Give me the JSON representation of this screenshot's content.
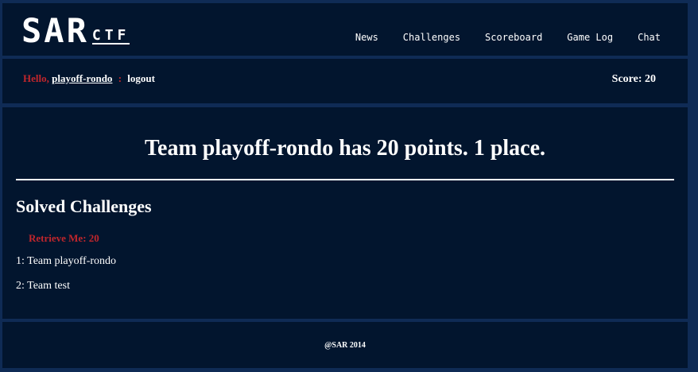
{
  "header": {
    "logo_big": "SAR",
    "logo_small": "CTF",
    "nav": [
      "News",
      "Challenges",
      "Scoreboard",
      "Game Log",
      "Chat"
    ]
  },
  "userbar": {
    "hello": "Hello,",
    "username": "playoff-rondo",
    "separator": ":",
    "logout": "logout",
    "score": "Score: 20"
  },
  "main": {
    "title": "Team playoff-rondo has 20 points. 1 place.",
    "solved_heading": "Solved Challenges",
    "challenge": "Retrieve Me: 20",
    "solvers": [
      "1: Team playoff-rondo",
      "2: Team test"
    ]
  },
  "footer": {
    "copyright": "@SAR 2014"
  },
  "colors": {
    "background": "#02152e",
    "frame": "#0f2b55",
    "accent_red": "#c0262c",
    "text": "#ffffff"
  }
}
